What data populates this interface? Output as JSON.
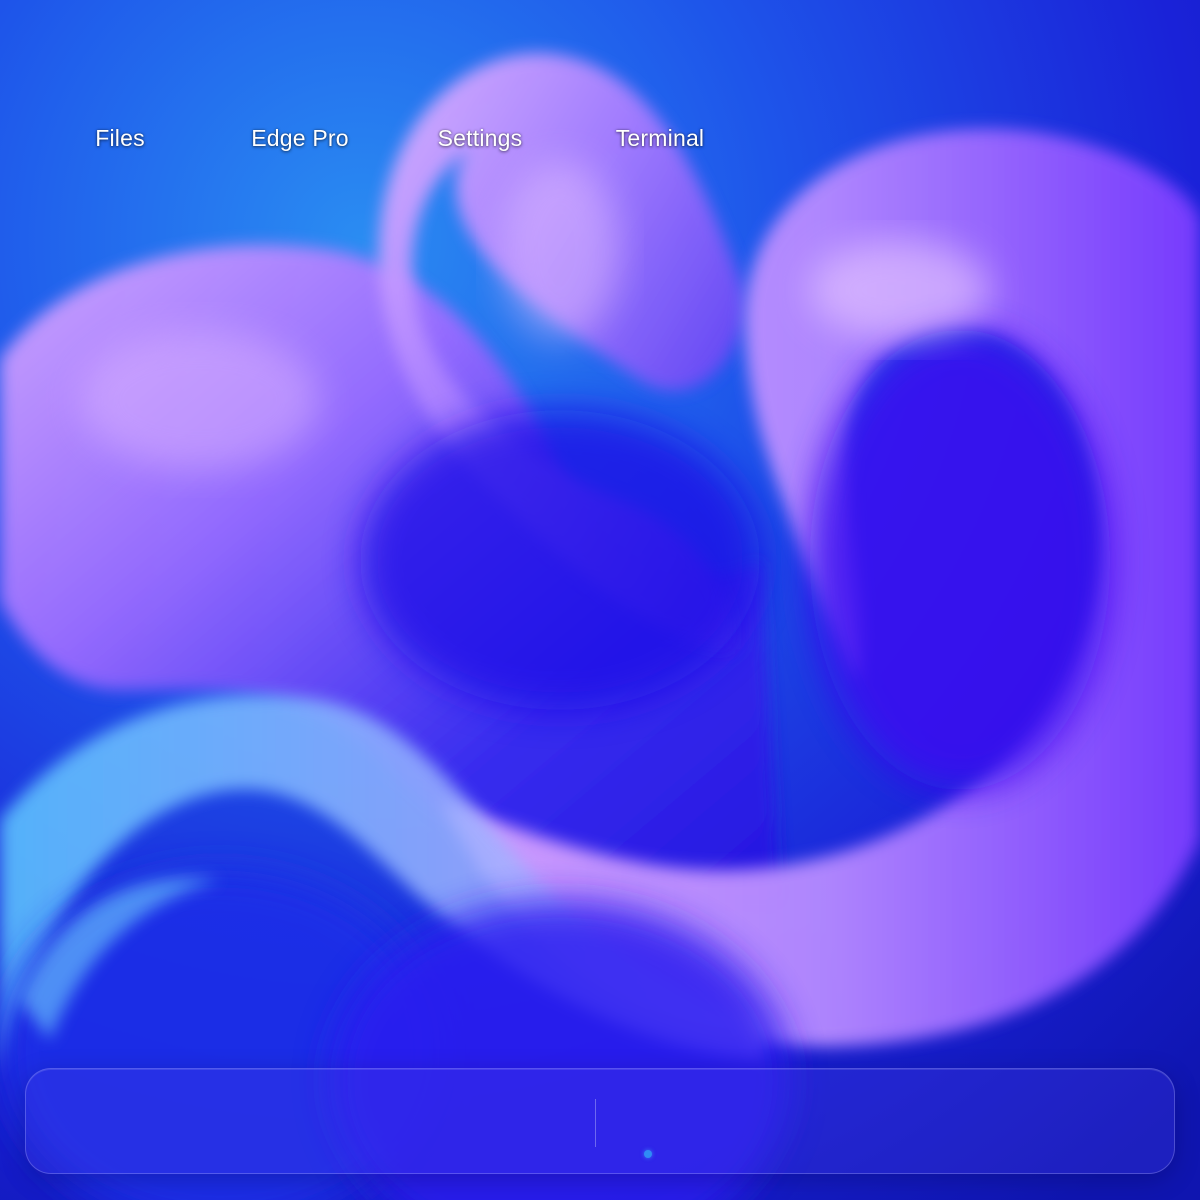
{
  "desktop": {
    "icons": [
      {
        "label": "Files"
      },
      {
        "label": "Edge Pro"
      },
      {
        "label": "Settings"
      },
      {
        "label": "Terminal"
      }
    ]
  },
  "taskbar": {
    "running_indicator_color": "#2f8cf5"
  },
  "colors": {
    "wallpaper_base": "#1a1fd6",
    "wallpaper_highlight": "#c9a8ff",
    "wallpaper_accent": "#6fd0ff"
  }
}
